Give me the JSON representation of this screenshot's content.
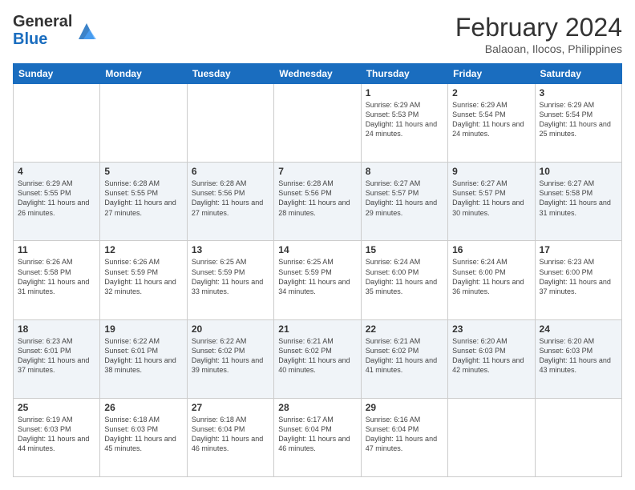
{
  "logo": {
    "general": "General",
    "blue": "Blue"
  },
  "title": "February 2024",
  "location": "Balaoan, Ilocos, Philippines",
  "days_of_week": [
    "Sunday",
    "Monday",
    "Tuesday",
    "Wednesday",
    "Thursday",
    "Friday",
    "Saturday"
  ],
  "weeks": [
    [
      {
        "day": "",
        "info": ""
      },
      {
        "day": "",
        "info": ""
      },
      {
        "day": "",
        "info": ""
      },
      {
        "day": "",
        "info": ""
      },
      {
        "day": "1",
        "info": "Sunrise: 6:29 AM\nSunset: 5:53 PM\nDaylight: 11 hours and 24 minutes."
      },
      {
        "day": "2",
        "info": "Sunrise: 6:29 AM\nSunset: 5:54 PM\nDaylight: 11 hours and 24 minutes."
      },
      {
        "day": "3",
        "info": "Sunrise: 6:29 AM\nSunset: 5:54 PM\nDaylight: 11 hours and 25 minutes."
      }
    ],
    [
      {
        "day": "4",
        "info": "Sunrise: 6:29 AM\nSunset: 5:55 PM\nDaylight: 11 hours and 26 minutes."
      },
      {
        "day": "5",
        "info": "Sunrise: 6:28 AM\nSunset: 5:55 PM\nDaylight: 11 hours and 27 minutes."
      },
      {
        "day": "6",
        "info": "Sunrise: 6:28 AM\nSunset: 5:56 PM\nDaylight: 11 hours and 27 minutes."
      },
      {
        "day": "7",
        "info": "Sunrise: 6:28 AM\nSunset: 5:56 PM\nDaylight: 11 hours and 28 minutes."
      },
      {
        "day": "8",
        "info": "Sunrise: 6:27 AM\nSunset: 5:57 PM\nDaylight: 11 hours and 29 minutes."
      },
      {
        "day": "9",
        "info": "Sunrise: 6:27 AM\nSunset: 5:57 PM\nDaylight: 11 hours and 30 minutes."
      },
      {
        "day": "10",
        "info": "Sunrise: 6:27 AM\nSunset: 5:58 PM\nDaylight: 11 hours and 31 minutes."
      }
    ],
    [
      {
        "day": "11",
        "info": "Sunrise: 6:26 AM\nSunset: 5:58 PM\nDaylight: 11 hours and 31 minutes."
      },
      {
        "day": "12",
        "info": "Sunrise: 6:26 AM\nSunset: 5:59 PM\nDaylight: 11 hours and 32 minutes."
      },
      {
        "day": "13",
        "info": "Sunrise: 6:25 AM\nSunset: 5:59 PM\nDaylight: 11 hours and 33 minutes."
      },
      {
        "day": "14",
        "info": "Sunrise: 6:25 AM\nSunset: 5:59 PM\nDaylight: 11 hours and 34 minutes."
      },
      {
        "day": "15",
        "info": "Sunrise: 6:24 AM\nSunset: 6:00 PM\nDaylight: 11 hours and 35 minutes."
      },
      {
        "day": "16",
        "info": "Sunrise: 6:24 AM\nSunset: 6:00 PM\nDaylight: 11 hours and 36 minutes."
      },
      {
        "day": "17",
        "info": "Sunrise: 6:23 AM\nSunset: 6:00 PM\nDaylight: 11 hours and 37 minutes."
      }
    ],
    [
      {
        "day": "18",
        "info": "Sunrise: 6:23 AM\nSunset: 6:01 PM\nDaylight: 11 hours and 37 minutes."
      },
      {
        "day": "19",
        "info": "Sunrise: 6:22 AM\nSunset: 6:01 PM\nDaylight: 11 hours and 38 minutes."
      },
      {
        "day": "20",
        "info": "Sunrise: 6:22 AM\nSunset: 6:02 PM\nDaylight: 11 hours and 39 minutes."
      },
      {
        "day": "21",
        "info": "Sunrise: 6:21 AM\nSunset: 6:02 PM\nDaylight: 11 hours and 40 minutes."
      },
      {
        "day": "22",
        "info": "Sunrise: 6:21 AM\nSunset: 6:02 PM\nDaylight: 11 hours and 41 minutes."
      },
      {
        "day": "23",
        "info": "Sunrise: 6:20 AM\nSunset: 6:03 PM\nDaylight: 11 hours and 42 minutes."
      },
      {
        "day": "24",
        "info": "Sunrise: 6:20 AM\nSunset: 6:03 PM\nDaylight: 11 hours and 43 minutes."
      }
    ],
    [
      {
        "day": "25",
        "info": "Sunrise: 6:19 AM\nSunset: 6:03 PM\nDaylight: 11 hours and 44 minutes."
      },
      {
        "day": "26",
        "info": "Sunrise: 6:18 AM\nSunset: 6:03 PM\nDaylight: 11 hours and 45 minutes."
      },
      {
        "day": "27",
        "info": "Sunrise: 6:18 AM\nSunset: 6:04 PM\nDaylight: 11 hours and 46 minutes."
      },
      {
        "day": "28",
        "info": "Sunrise: 6:17 AM\nSunset: 6:04 PM\nDaylight: 11 hours and 46 minutes."
      },
      {
        "day": "29",
        "info": "Sunrise: 6:16 AM\nSunset: 6:04 PM\nDaylight: 11 hours and 47 minutes."
      },
      {
        "day": "",
        "info": ""
      },
      {
        "day": "",
        "info": ""
      }
    ]
  ]
}
